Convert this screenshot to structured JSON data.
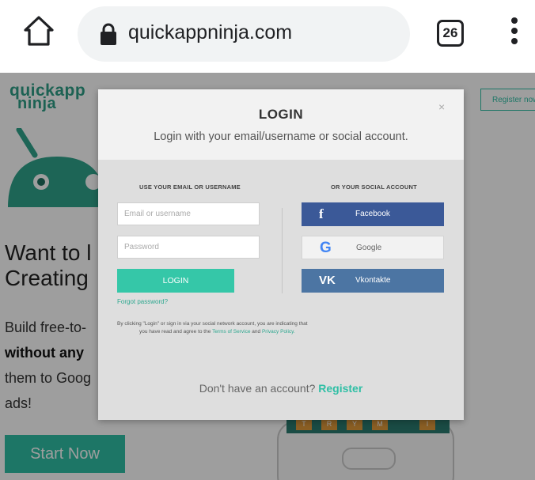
{
  "browser": {
    "url": "quickappninja.com",
    "tab_count": "26"
  },
  "site": {
    "logo_line1": "quickapp",
    "logo_line2": "ninja",
    "register_button": "Register now",
    "hero_title_line1": "Want to l",
    "hero_title_line2": "Creating",
    "hero_text_line1": "Build free-to-",
    "hero_text_line2": "without any",
    "hero_text_line3": "them to Goog",
    "hero_text_line4": "ads!",
    "start_button": "Start Now",
    "keys": [
      "T",
      "R",
      "Y",
      "M",
      "I"
    ]
  },
  "modal": {
    "title": "LOGIN",
    "subtitle": "Login with your email/username or social account.",
    "close": "×",
    "left_heading": "USE YOUR EMAIL OR USERNAME",
    "right_heading": "OR YOUR SOCIAL ACCOUNT",
    "email_placeholder": "Email or username",
    "password_placeholder": "Password",
    "login_button": "LOGIN",
    "forgot_link": "Forgot password?",
    "facebook_label": "Facebook",
    "google_label": "Google",
    "vk_label": "Vkontakte",
    "terms_text_1": "By clicking \"Login\" or sign in via your social network account, you are indicating that",
    "terms_text_2": "you have read and agree to the",
    "terms_link": "Terms of Service",
    "terms_and": "and",
    "privacy_link": "Privacy Policy.",
    "no_account_text": "Don't have an account?",
    "register_link": "Register"
  },
  "colors": {
    "accent": "#2fbfa5",
    "facebook": "#3b5998",
    "vkontakte": "#4c75a3"
  }
}
